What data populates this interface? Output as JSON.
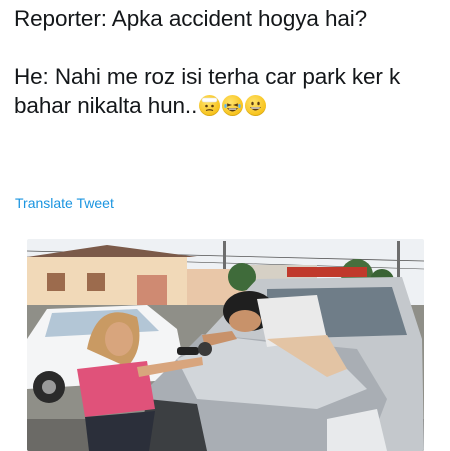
{
  "tweet": {
    "line1": "Reporter: Apka accident hogya hai?",
    "line2": "He: Nahi me roz isi terha car park ker k bahar nikalta hun..",
    "emojis": [
      "thinking-bandage-face-icon",
      "laughing-face-icon",
      "grinning-face-icon"
    ],
    "translate_label": "Translate Tweet"
  },
  "photo": {
    "description_icon": "news-photo",
    "colors": {
      "sky": "#eef1f4",
      "car_silver": "#b7bcc2",
      "reporter_top": "#e0527a"
    }
  }
}
